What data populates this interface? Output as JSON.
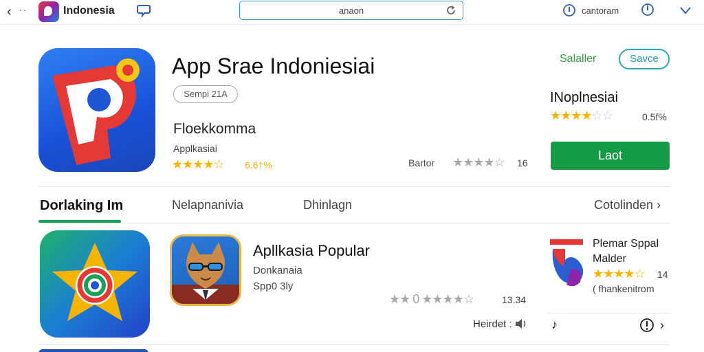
{
  "topbar": {
    "title": "Indonesia",
    "address": "anaon",
    "user_label": "cantoram"
  },
  "hero": {
    "title": "App Srae Indoniesiai",
    "pill": "Sempi 21A",
    "developer": "Floekkomma",
    "category": "Applkasiai",
    "stars": "★★★★☆",
    "score": "6.6†%",
    "sort_label": "Bartor",
    "stars2": "★★★★☆",
    "count2": "16"
  },
  "side": {
    "link": "Salaller",
    "save_label": "Savce",
    "name": "INoplnesiai",
    "stars_full": "★★★★",
    "stars_dim": "☆☆",
    "score": "0.5f%",
    "button_label": "Laot"
  },
  "tabs": [
    {
      "label": "Dorlaking Im"
    },
    {
      "label": "Nelapnanivia"
    },
    {
      "label": "Dhinlagn"
    },
    {
      "label": "Cotolinden ›"
    }
  ],
  "card": {
    "title": "Apllkasia Popular",
    "subtitle": "Donkanaia",
    "meta": "Spp0 3ly",
    "stars": "★★ 0 ★★★★☆",
    "count": "13.34",
    "action_label": "Heirdet :"
  },
  "right": {
    "title": "Plemar Sppal Malder",
    "stars": "★★★★☆",
    "count": "14",
    "note": "( fhankenitrom",
    "b1": "♪",
    "b3": "›"
  },
  "colors": {
    "primary_green": "#159a45",
    "accent_teal": "#2ba9b0",
    "star_gold": "#f5b400",
    "address_border": "#3d8fd1"
  }
}
